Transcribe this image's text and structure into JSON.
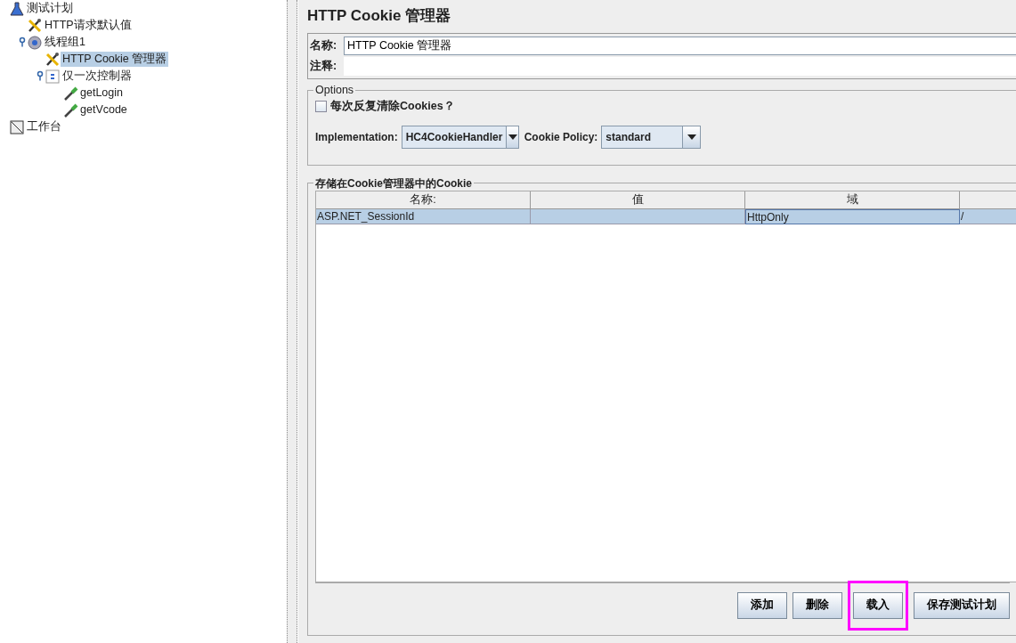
{
  "tree": [
    {
      "label": "测试计划",
      "kind": "flask",
      "selected": false,
      "children": [
        {
          "label": "HTTP请求默认值",
          "kind": "tools",
          "selected": false
        },
        {
          "label": "线程组1",
          "kind": "gear",
          "expanded": true,
          "selected": false,
          "children": [
            {
              "label": "HTTP Cookie 管理器",
              "kind": "tools",
              "selected": true
            },
            {
              "label": "仅一次控制器",
              "kind": "controller",
              "expanded": true,
              "selected": false,
              "children": [
                {
                  "label": "getLogin",
                  "kind": "sampler",
                  "selected": false
                },
                {
                  "label": "getVcode",
                  "kind": "sampler",
                  "selected": false
                }
              ]
            }
          ]
        }
      ]
    },
    {
      "label": "工作台",
      "kind": "workbench",
      "selected": false
    }
  ],
  "panel": {
    "title": "HTTP Cookie 管理器",
    "name_label": "名称:",
    "name_value": "HTTP Cookie 管理器",
    "comment_label": "注释:",
    "options": {
      "legend": "Options",
      "clear_each_iteration": {
        "label": "每次反复清除Cookies？",
        "checked": false
      },
      "implementation": {
        "label": "Implementation:",
        "value": "HC4CookieHandler"
      },
      "policy": {
        "label": "Cookie Policy:",
        "value": "standard"
      }
    },
    "cookies": {
      "legend": "存储在Cookie管理器中的Cookie",
      "columns": [
        "名称:",
        "值",
        "域"
      ],
      "rows": [
        {
          "cells": [
            {
              "text": "ASP.NET_SessionId",
              "focused": false
            },
            {
              "focused": false
            },
            {
              "text": "HttpOnly",
              "focused": true
            },
            {
              "text": "/",
              "focused": false
            }
          ],
          "selected": true
        }
      ]
    },
    "buttons": [
      {
        "label": "添加",
        "highlighted": false
      },
      {
        "label": "删除",
        "highlighted": false
      },
      {
        "label": "载入",
        "highlighted": true
      },
      {
        "label": "保存测试计划",
        "highlighted": false
      }
    ]
  }
}
